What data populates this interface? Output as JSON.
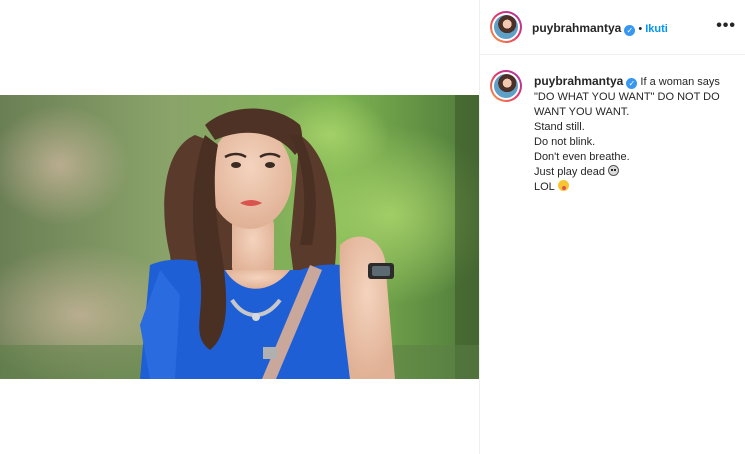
{
  "post": {
    "username": "puybrahmantya",
    "verified_badge": "✓",
    "dot": "•",
    "follow_label": "Ikuti",
    "more_label": "•••"
  },
  "caption": {
    "username": "puybrahmantya",
    "lines": [
      "If a woman says",
      "\"DO WHAT YOU WANT\" DO NOT DO",
      "WANT YOU WANT.",
      "Stand still.",
      "Do not blink.",
      "Don't even breathe.",
      "Just play dead",
      "LOL"
    ],
    "emoji_names": [
      "skull-emoji",
      "crazy-face-emoji"
    ]
  },
  "colors": {
    "accent": "#0095f6",
    "verified": "#3897f0",
    "border": "#efefef",
    "text": "#262626"
  }
}
